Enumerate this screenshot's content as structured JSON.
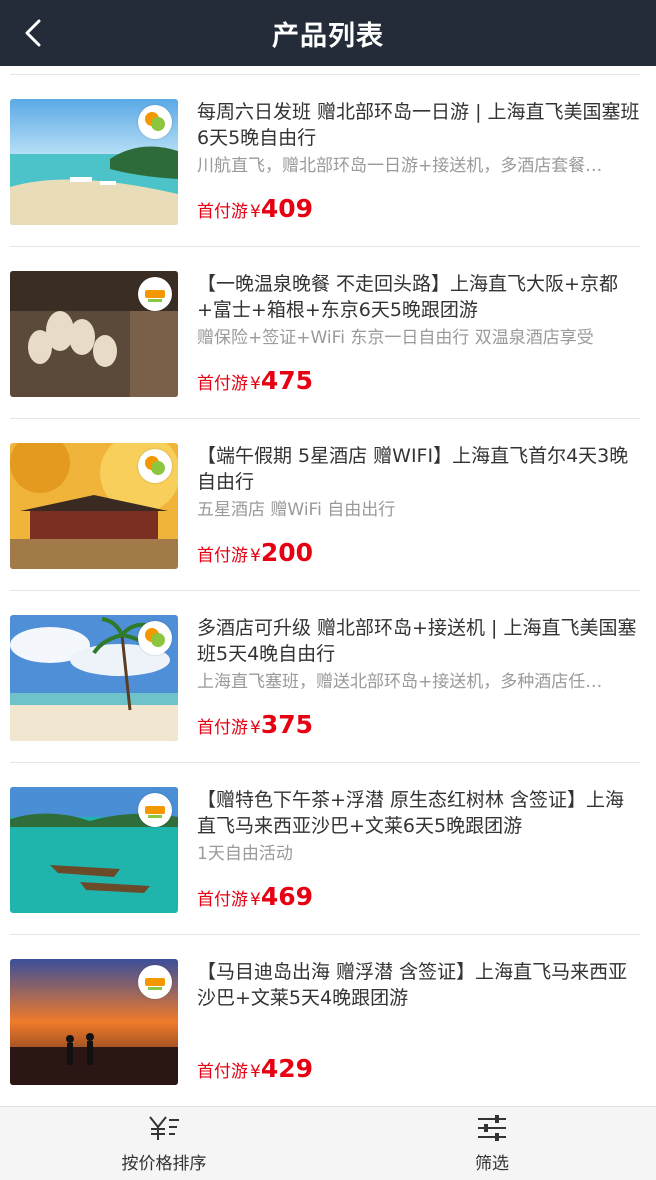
{
  "header": {
    "title": "产品列表",
    "back_icon": "chevron-left-icon"
  },
  "colors": {
    "header_bg": "#232c38",
    "price": "#e60012",
    "tabbar_bg": "#f5f5f5"
  },
  "products": [
    {
      "name": "每周六日发班 赠北部环岛一日游 | 上海直飞美国塞班6天5晚自由行",
      "desc": "川航直飞，赠北部环岛一日游+接送机，多酒店套餐…",
      "price_label": "首付游",
      "currency": "¥",
      "price": "409",
      "image": "beach-boats-image"
    },
    {
      "name": "【一晚温泉晚餐 不走回头路】上海直飞大阪+京都+富士+箱根+东京6天5晚跟团游",
      "desc": "赠保险+签证+WiFi 东京一日自由行 双温泉酒店享受",
      "price_label": "首付游",
      "currency": "¥",
      "price": "475",
      "image": "wish-plaques-image"
    },
    {
      "name": "【端午假期 5星酒店 赠WIFI】上海直飞首尔4天3晚自由行",
      "desc": "五星酒店 赠WiFi 自由出行",
      "price_label": "首付游",
      "currency": "¥",
      "price": "200",
      "image": "korean-palace-image"
    },
    {
      "name": "多酒店可升级 赠北部环岛+接送机 | 上海直飞美国塞班5天4晚自由行",
      "desc": "上海直飞塞班，赠送北部环岛+接送机，多种酒店任…",
      "price_label": "首付游",
      "currency": "¥",
      "price": "375",
      "image": "palm-beach-image"
    },
    {
      "name": "【赠特色下午茶+浮潜 原生态红树林 含签证】上海直飞马来西亚沙巴+文莱6天5晚跟团游",
      "desc": "1天自由活动",
      "price_label": "首付游",
      "currency": "¥",
      "price": "469",
      "image": "lagoon-boats-image"
    },
    {
      "name": "【马目迪岛出海 赠浮潜 含签证】上海直飞马来西亚沙巴+文莱5天4晚跟团游",
      "desc": "",
      "price_label": "首付游",
      "currency": "¥",
      "price": "429",
      "image": "sunset-couple-image"
    }
  ],
  "tabbar": {
    "sort_label": "按价格排序",
    "sort_icon": "yen-sort-icon",
    "filter_label": "筛选",
    "filter_icon": "filter-sliders-icon"
  }
}
